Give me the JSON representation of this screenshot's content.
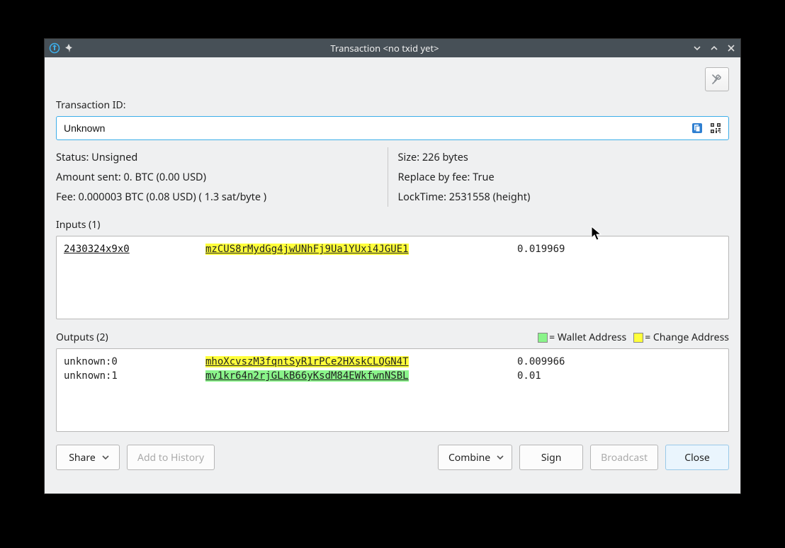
{
  "titlebar": {
    "title": "Transaction <no txid yet>"
  },
  "labels": {
    "txid": "Transaction ID:",
    "inputs": "Inputs (1)",
    "outputs": "Outputs (2)",
    "legend_wallet": "= Wallet Address",
    "legend_change": "= Change Address"
  },
  "txid": {
    "value": "Unknown"
  },
  "info": {
    "status": "Status: Unsigned",
    "amount": "Amount sent: 0. BTC (0.00 USD)",
    "fee": "Fee: 0.000003 BTC (0.08 USD)  ( 1.3 sat/byte )",
    "size": "Size: 226 bytes",
    "rbf": "Replace by fee: True",
    "locktime": "LockTime: 2531558 (height)"
  },
  "inputs": [
    {
      "ref": "2430324x9x0",
      "address": "mzCUS8rMydGg4jwUNhFj9Ua1YUxi4JGUE1",
      "addr_class": "hl-yellow",
      "amount": "0.019969"
    }
  ],
  "outputs": [
    {
      "ref": "unknown:0",
      "address": "mhoXcvszM3fqntSyR1rPCe2HXskCLQGN4T",
      "addr_class": "hl-yellow",
      "amount": "0.009966"
    },
    {
      "ref": "unknown:1",
      "address": "mv1kr64n2rjGLkB66yKsdM84EWkfwnNSBL",
      "addr_class": "hl-green",
      "amount": "0.01"
    }
  ],
  "buttons": {
    "share": "Share",
    "add_history": "Add to History",
    "combine": "Combine",
    "sign": "Sign",
    "broadcast": "Broadcast",
    "close": "Close"
  }
}
